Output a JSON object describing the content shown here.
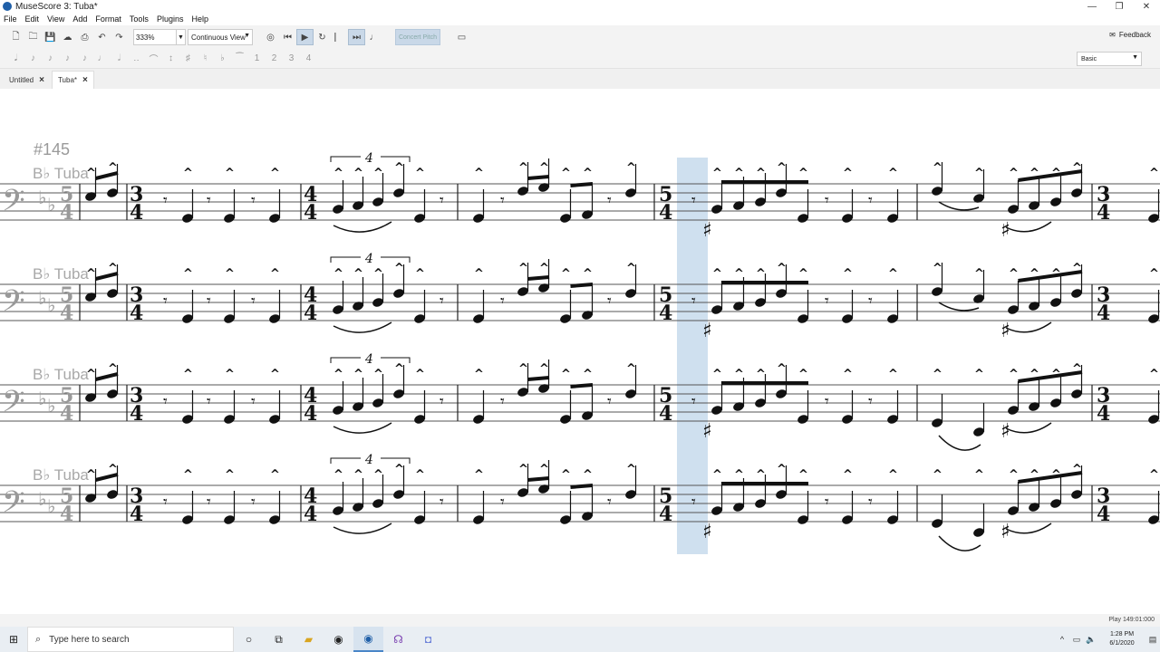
{
  "window": {
    "title": "MuseScore 3: Tuba*"
  },
  "window_controls": {
    "minimize": "—",
    "maximize": "❐",
    "close": "✕"
  },
  "menu": [
    "File",
    "Edit",
    "View",
    "Add",
    "Format",
    "Tools",
    "Plugins",
    "Help"
  ],
  "toolbar": {
    "zoom": "333%",
    "view_mode": "Continuous View",
    "concert_pitch": "Concert Pitch",
    "feedback": "Feedback"
  },
  "note_input": {
    "workspace": "Basic"
  },
  "tabs": [
    {
      "label": "Untitled",
      "active": false
    },
    {
      "label": "Tuba*",
      "active": true
    }
  ],
  "score": {
    "rehearsal_mark": "#145",
    "staff_label": "B♭ Tuba",
    "tuplet_number": "4",
    "systems": 4,
    "selection_color": "#cfe0ef"
  },
  "status": {
    "text": "Play   149:01:000"
  },
  "taskbar": {
    "search_placeholder": "Type here to search",
    "time": "1:28 PM",
    "date": "6/1/2020"
  }
}
